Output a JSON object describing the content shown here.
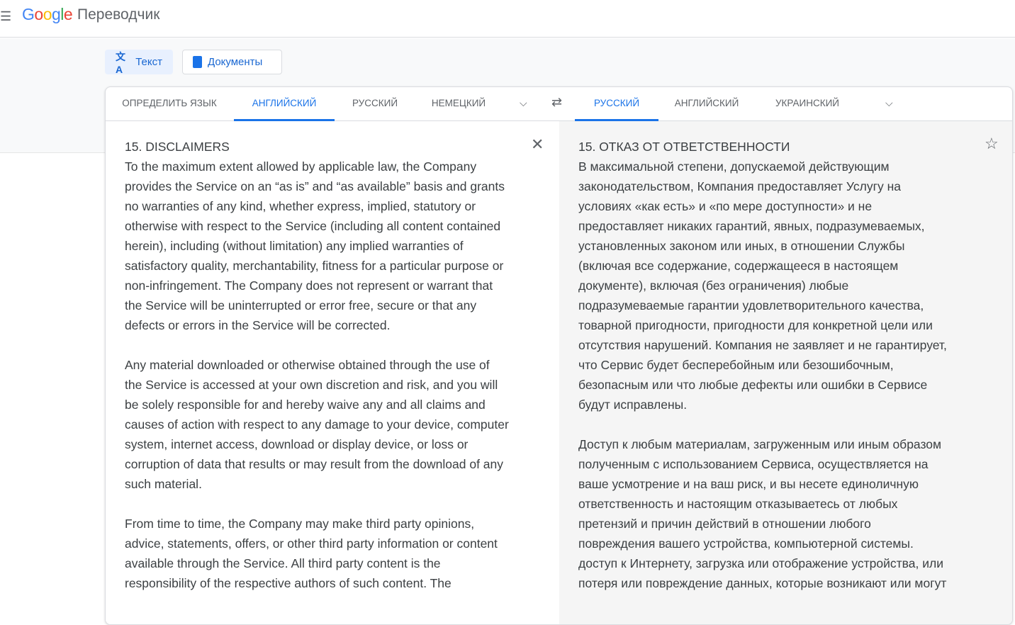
{
  "header": {
    "menu_icon": "hamburger-icon",
    "logo": "Google",
    "product": "Переводчик"
  },
  "modes": {
    "text": "Текст",
    "documents": "Документы"
  },
  "source_tabs": [
    "ОПРЕДЕЛИТЬ ЯЗЫК",
    "АНГЛИЙСКИЙ",
    "РУССКИЙ",
    "НЕМЕЦКИЙ"
  ],
  "target_tabs": [
    "РУССКИЙ",
    "АНГЛИЙСКИЙ",
    "УКРАИНСКИЙ"
  ],
  "source_lines": [
    "15. DISCLAIMERS",
    "To the maximum extent allowed by applicable law, the Company",
    "provides the Service on an “as is” and “as available” basis and grants",
    "no warranties of any kind, whether express, implied, statutory or",
    "otherwise with respect to the Service (including all content contained",
    "herein), including (without limitation) any implied warranties of",
    "satisfactory quality, merchantability, fitness for a particular purpose or",
    "non-infringement. The Company does not represent or warrant that",
    "the Service will be uninterrupted or error free, secure or that any",
    "defects or errors in the Service will be corrected.",
    "",
    "Any material downloaded or otherwise obtained through the use of",
    "the Service is accessed at your own discretion and risk, and you will",
    "be solely responsible for and hereby waive any and all claims and",
    "causes of action with respect to any damage to your device, computer",
    "system, internet access, download or display device, or loss or",
    "corruption of data that results or may result from the download of any",
    "such material.",
    "",
    "From time to time, the Company may make third party opinions,",
    "advice, statements, offers, or other third party information or content",
    "available through the Service. All third party content is the",
    "responsibility of the respective authors of such content. The"
  ],
  "target_lines": [
    "15. ОТКАЗ ОТ ОТВЕТСТВЕННОСТИ",
    "В максимальной степени, допускаемой действующим",
    "законодательством, Компания предоставляет Услугу на",
    "условиях «как есть» и «по мере доступности» и не",
    "предоставляет никаких гарантий, явных, подразумеваемых,",
    "установленных законом или иных, в отношении Службы",
    "(включая все содержание, содержащееся в настоящем",
    "документе), включая (без ограничения) любые",
    "подразумеваемые гарантии удовлетворительного качества,",
    "товарной пригодности, пригодности для конкретной цели или",
    "отсутствия нарушений. Компания не заявляет и не гарантирует,",
    "что Сервис будет бесперебойным или безошибочным,",
    "безопасным или что любые дефекты или ошибки в Сервисе",
    "будут исправлены.",
    "",
    "Доступ к любым материалам, загруженным или иным образом",
    "полученным с использованием Сервиса, осуществляется на",
    "ваше усмотрение и на ваш риск, и вы несете единоличную",
    "ответственность и настоящим отказываетесь от любых",
    "претензий и причин действий в отношении любого",
    "повреждения вашего устройства, компьютерной системы.",
    "доступ к Интернету, загрузка или отображение устройства, или",
    "потеря или повреждение данных, которые возникают или могут"
  ]
}
